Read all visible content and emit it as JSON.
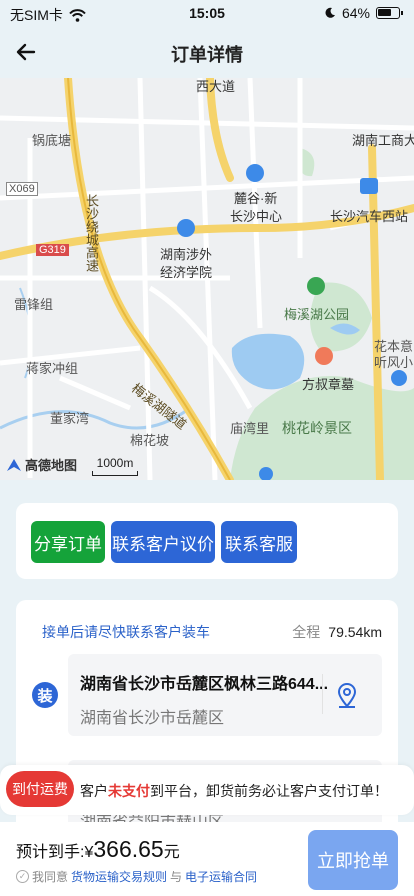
{
  "status_bar": {
    "carrier": "无SIM卡",
    "time": "15:05",
    "battery": "64%",
    "battery_level": 0.64
  },
  "nav": {
    "title": "订单详情"
  },
  "map": {
    "labels": {
      "rd_top": "西大道",
      "gdt": "锅底塘",
      "hngd": "湖南工商大",
      "x069": "X069",
      "g319": "G319",
      "rc_road": "长沙绕城高速",
      "lugu": "麓谷·新",
      "lugu2": "长沙中心",
      "cs_station": "长沙汽车西站",
      "hnsw": "湖南涉外",
      "hnsw2": "经济学院",
      "lfz": "雷锋组",
      "mxh_park": "梅溪湖公园",
      "hbt": "花本意",
      "tfzl": "听风小",
      "jjcz": "蒋家冲组",
      "mxh_tunnel": "梅溪湖隧道",
      "fsz": "方叔章墓",
      "djw": "董家湾",
      "twl": "庙湾里",
      "thl": "桃花岭景区",
      "mhp": "棉花坡",
      "amap": "高德地图",
      "scale": "1000m"
    }
  },
  "actions": {
    "share": "分享订单",
    "negotiate": "联系客户议价",
    "service": "联系客服"
  },
  "route": {
    "hint": "接单后请尽快联系客户装车",
    "distance_label": "全程",
    "distance_value": "79.54km",
    "load_badge": "装",
    "load_address": "湖南省长沙市岳麓区枫林三路644...",
    "load_district": "湖南省长沙市岳麓区",
    "unload_district": "湖南省益阳市赫山区"
  },
  "banner": {
    "tag": "到付运费",
    "msg_pre": "客户",
    "msg_red": "未支付",
    "msg_post": "到平台，卸货前务必让客户支付订单！"
  },
  "bottom": {
    "price_label": "预计到手:",
    "currency": "¥",
    "price": "366.65",
    "unit": "元",
    "agree_pre": "我同意",
    "rule_link": "货物运输交易规则",
    "and": "与",
    "contract_link": "电子运输合同",
    "grab_button": "立即抢单"
  }
}
